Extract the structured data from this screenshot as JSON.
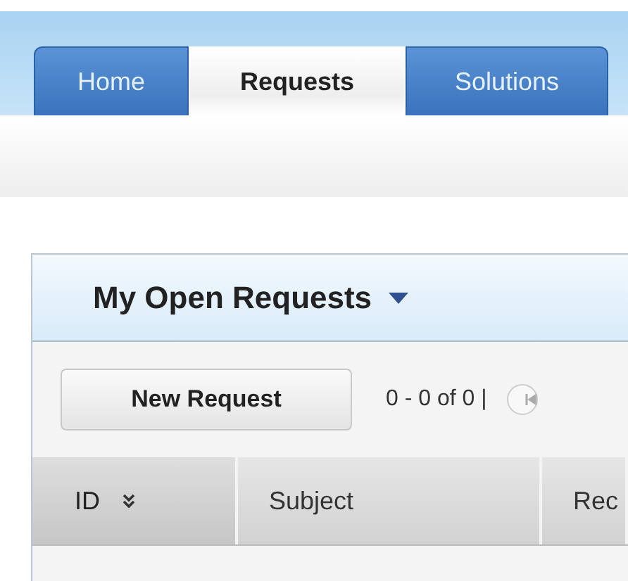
{
  "tabs": [
    {
      "label": "Home",
      "selected": false
    },
    {
      "label": "Requests",
      "selected": true
    },
    {
      "label": "Solutions",
      "selected": false
    }
  ],
  "panel": {
    "title": "My Open Requests",
    "new_button": "New Request",
    "pager": "0 - 0 of 0 |",
    "columns": [
      {
        "label": "ID",
        "sorted": true
      },
      {
        "label": "Subject",
        "sorted": false
      },
      {
        "label": "Rec",
        "sorted": false
      }
    ]
  }
}
